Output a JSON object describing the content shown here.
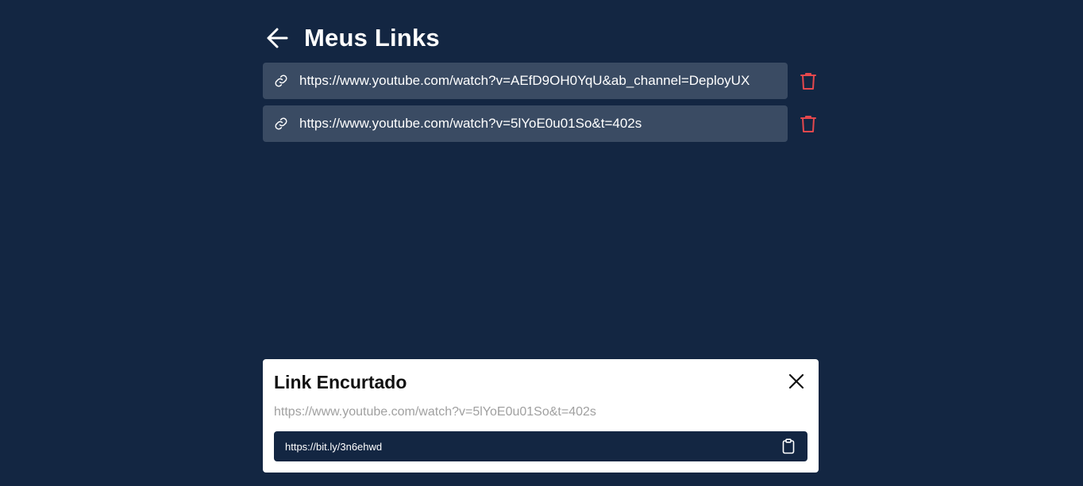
{
  "header": {
    "title": "Meus Links",
    "back_icon": "arrow-left-icon"
  },
  "links": [
    {
      "url": "https://www.youtube.com/watch?v=AEfD9OH0YqU&ab_channel=DeployUX",
      "icon": "link-icon",
      "delete_icon": "trash-icon"
    },
    {
      "url": "https://www.youtube.com/watch?v=5lYoE0u01So&t=402s",
      "icon": "link-icon",
      "delete_icon": "trash-icon"
    }
  ],
  "modal": {
    "title": "Link Encurtado",
    "original_url": "https://www.youtube.com/watch?v=5lYoE0u01So&t=402s",
    "short_url": "https://bit.ly/3n6ehwd",
    "close_icon": "close-icon",
    "copy_icon": "clipboard-icon"
  },
  "colors": {
    "background": "#132642",
    "link_item_bg": "#3a4b63",
    "delete_red": "#e5484d",
    "modal_bg": "#ffffff"
  }
}
